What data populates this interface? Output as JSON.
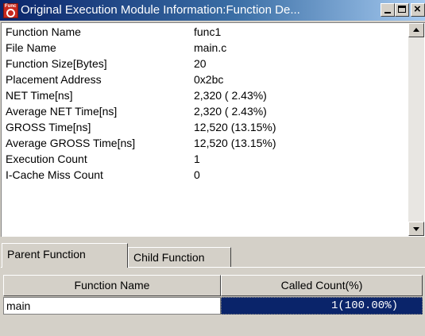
{
  "window": {
    "title": "Original Execution Module Information:Function De...",
    "icon": "func-magnifier-icon",
    "buttons": {
      "minimize": "minimize-icon",
      "maximize": "maximize-icon",
      "close": "×"
    }
  },
  "info": {
    "rows": [
      {
        "label": "Function Name",
        "value": "func1"
      },
      {
        "label": "File Name",
        "value": "main.c"
      },
      {
        "label": "Function Size[Bytes]",
        "value": "20"
      },
      {
        "label": "Placement Address",
        "value": "0x2bc"
      },
      {
        "label": "NET Time[ns]",
        "value": "2,320 ( 2.43%)"
      },
      {
        "label": "Average NET Time[ns]",
        "value": "2,320 ( 2.43%)"
      },
      {
        "label": "GROSS Time[ns]",
        "value": "12,520 (13.15%)"
      },
      {
        "label": "Average GROSS Time[ns]",
        "value": "12,520 (13.15%)"
      },
      {
        "label": "Execution Count",
        "value": "1"
      },
      {
        "label": "I-Cache Miss Count",
        "value": "0"
      }
    ]
  },
  "tabs": [
    {
      "label": "Parent Function",
      "active": true
    },
    {
      "label": "Child Function",
      "active": false
    }
  ],
  "table": {
    "headers": [
      "Function Name",
      "Called Count(%)"
    ],
    "rows": [
      {
        "name": "main",
        "count": "1(100.00%)"
      }
    ]
  },
  "colors": {
    "title_start": "#0a246a",
    "title_end": "#a6caf0",
    "selection": "#0a246a",
    "face": "#d4d0c8"
  }
}
